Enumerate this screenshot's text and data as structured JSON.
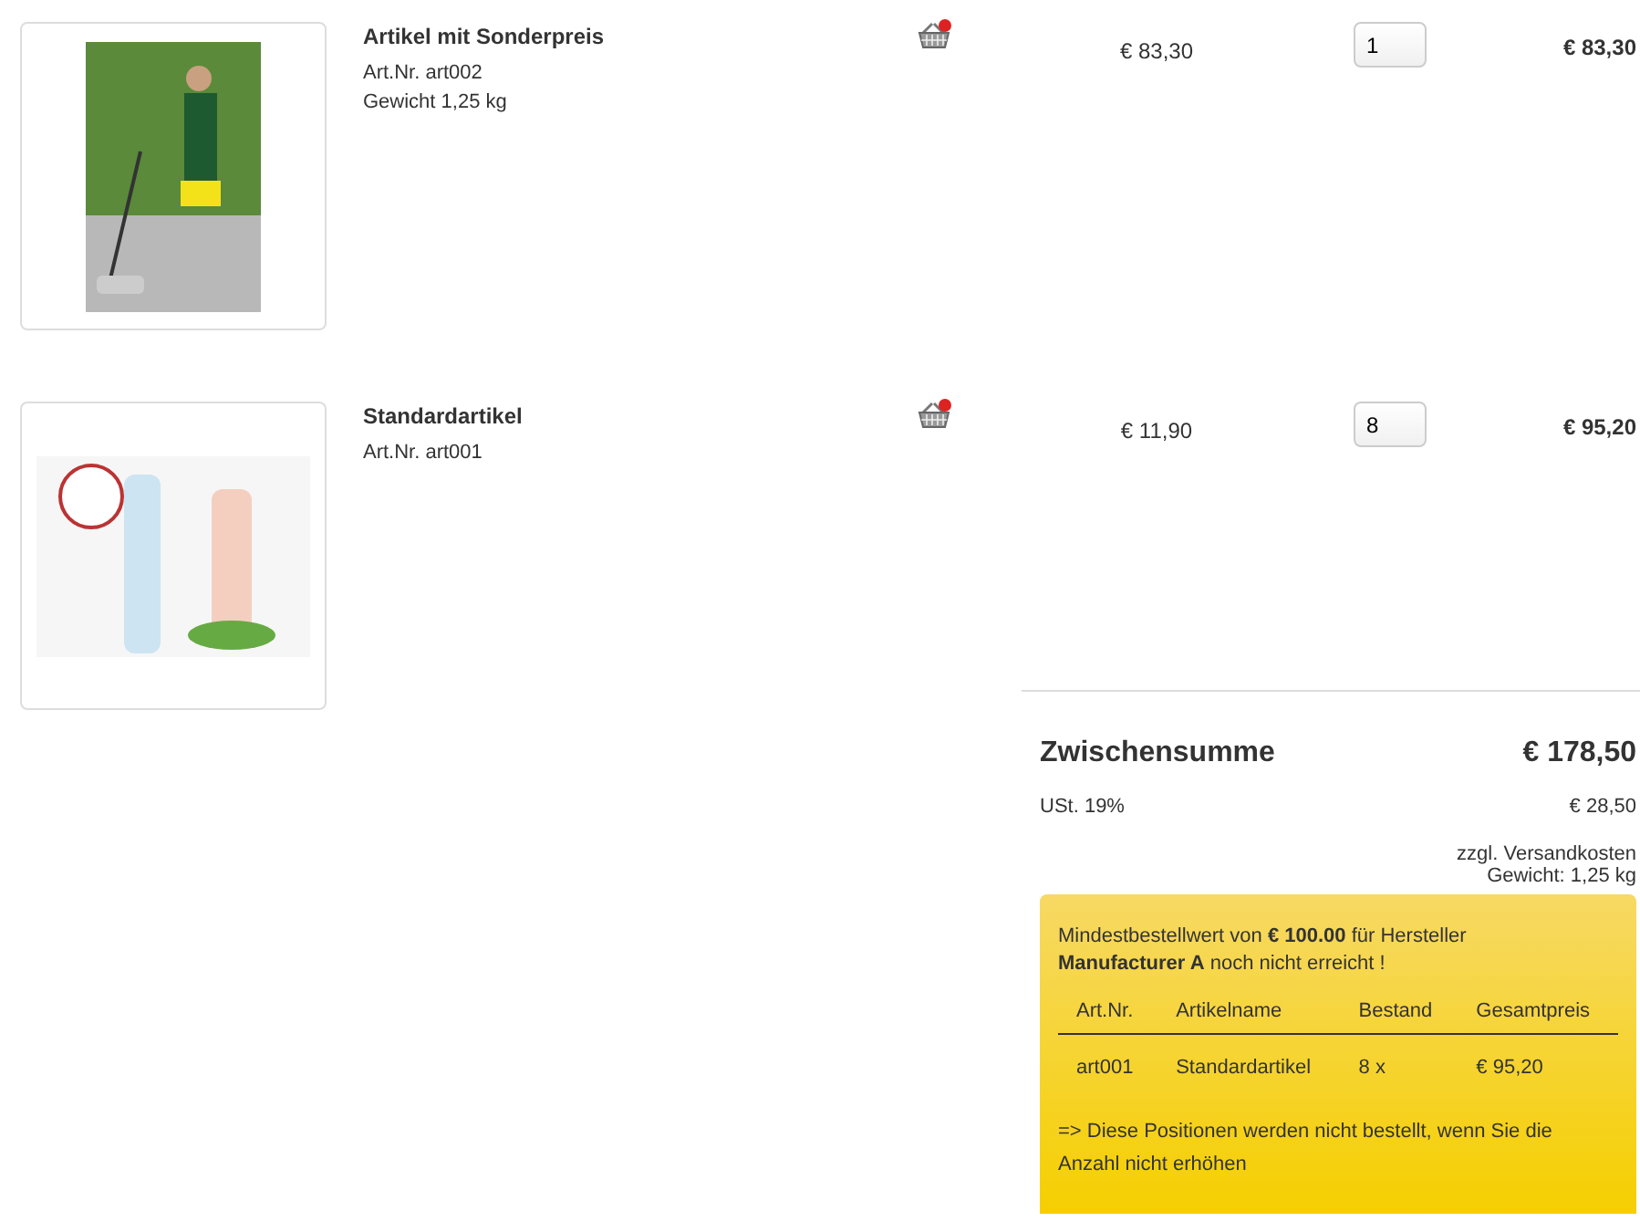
{
  "cart_items": [
    {
      "name": "Artikel mit Sonderpreis",
      "details": [
        "Art.Nr. art002",
        "Gewicht 1,25 kg"
      ],
      "unit_price": "€ 83,30",
      "quantity": "1",
      "total": "€ 83,30",
      "kind": "person"
    },
    {
      "name": "Standardartikel",
      "details": [
        "Art.Nr. art001"
      ],
      "unit_price": "€ 11,90",
      "quantity": "8",
      "total": "€ 95,20",
      "kind": "bottles"
    }
  ],
  "summary": {
    "subtotal_label": "Zwischensumme",
    "subtotal": "€ 178,50",
    "tax_label": "USt. 19%",
    "tax": "€ 28,50",
    "shipping_note": "zzgl. Versandkosten",
    "weight": "Gewicht: 1,25 kg"
  },
  "notice": {
    "message": "Mindestbestellwert von **€ 100.00** für Hersteller **Manufacturer A** noch nicht erreicht !",
    "columns": [
      "Art.Nr.",
      "Artikelname",
      "Bestand",
      "Gesamtpreis"
    ],
    "rows": [
      [
        "art001",
        "Standardartikel",
        "8 x",
        "€ 95,20"
      ]
    ],
    "footer": "=> Diese Positionen werden nicht bestellt, wenn Sie die Anzahl nicht erhöhen"
  }
}
